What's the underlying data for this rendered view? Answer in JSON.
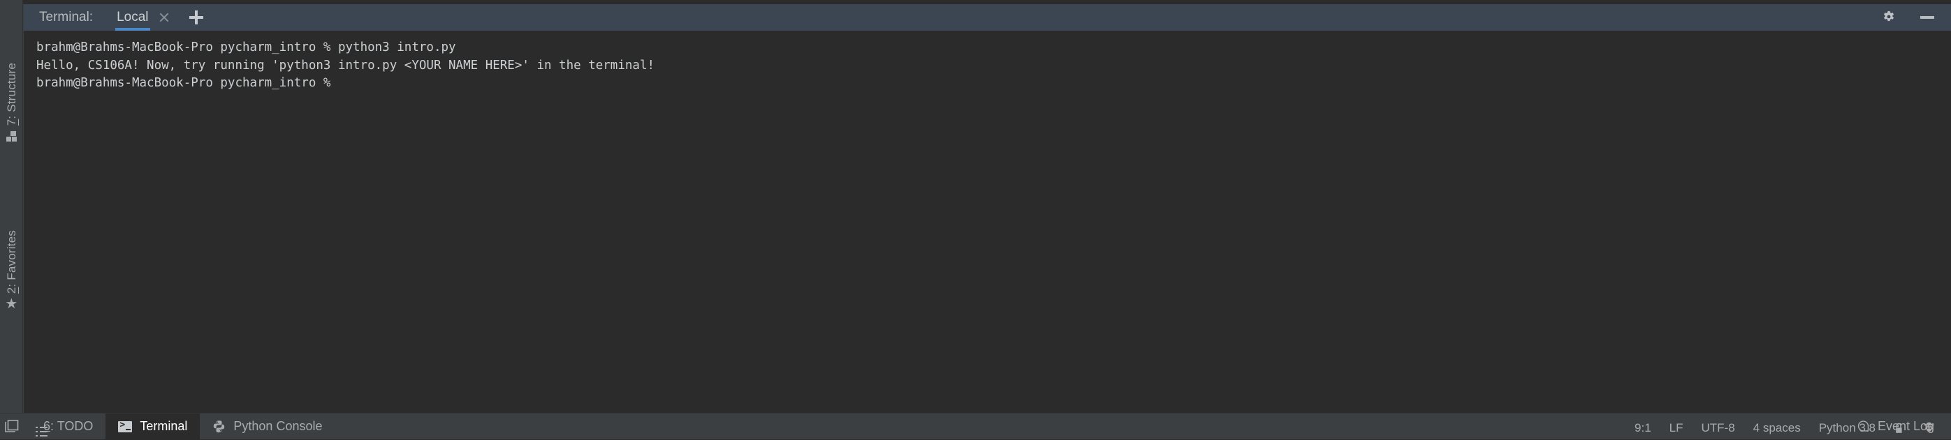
{
  "window": {
    "tool_window_title": "Terminal:",
    "tab": {
      "label": "Local",
      "close_icon": "close-icon"
    },
    "add_tab_icon": "plus-icon",
    "settings_icon": "gear-icon",
    "hide_icon": "minimize-icon",
    "accent_color": "#4a88c7",
    "header_bg": "#3c4552",
    "terminal_bg": "#2b2b2b",
    "chrome_bg": "#3c3f41"
  },
  "left_rail": {
    "items": [
      {
        "number": "7",
        "label": ": Structure",
        "icon": "structure-icon"
      },
      {
        "number": "2",
        "label": ": Favorites",
        "icon": "star-icon"
      }
    ]
  },
  "terminal": {
    "lines": [
      "brahm@Brahms-MacBook-Pro pycharm_intro % python3 intro.py",
      "Hello, CS106A! Now, try running 'python3 intro.py <YOUR NAME HERE>' in the terminal!",
      "brahm@Brahms-MacBook-Pro pycharm_intro % "
    ]
  },
  "bottom_bar": {
    "show_tool_windows_icon": "window-stack-icon",
    "tabs": [
      {
        "number": "6",
        "label": ": TODO",
        "icon": "todo-list-icon",
        "active": false
      },
      {
        "number": "",
        "label": "Terminal",
        "icon": "terminal-icon",
        "active": true
      },
      {
        "number": "",
        "label": "Python Console",
        "icon": "python-icon",
        "active": false
      }
    ],
    "event_log": {
      "label": "Event Log",
      "icon": "event-log-icon"
    }
  },
  "status_bar": {
    "caret_position": "9:1",
    "line_separator": "LF",
    "encoding": "UTF-8",
    "indent": "4 spaces",
    "interpreter": "Python 3.8",
    "lock_icon": "unlocked-icon",
    "inspector_icon": "inspector-icon"
  }
}
